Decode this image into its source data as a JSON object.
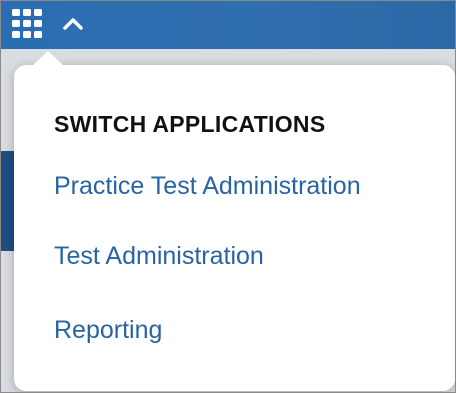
{
  "header": {
    "apps_icon": "app-grid-icon",
    "toggle_icon": "chevron-up-icon",
    "bar_color": "#2a6db2"
  },
  "popup": {
    "title": "SWITCH APPLICATIONS",
    "items": [
      {
        "label": "Practice Test Administration"
      },
      {
        "label": "Test Administration"
      },
      {
        "label": "Reporting"
      }
    ],
    "link_color": "#2864a4"
  }
}
